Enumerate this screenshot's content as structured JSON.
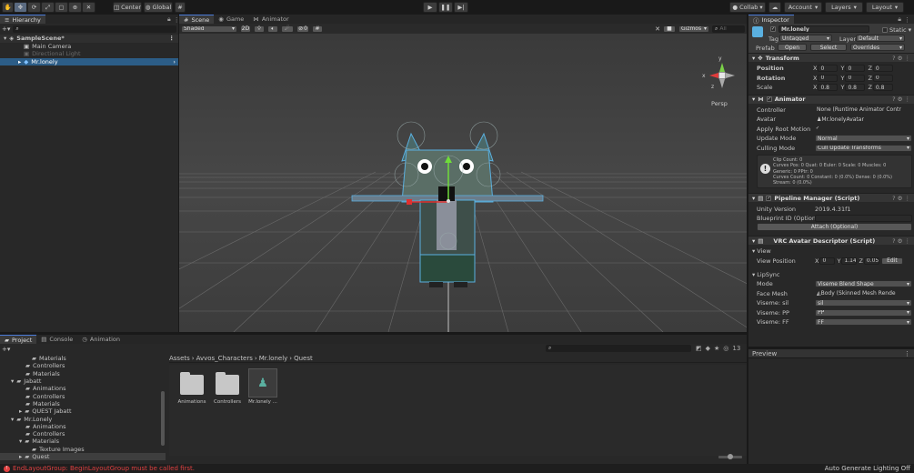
{
  "toolbar": {
    "center_label": "Center",
    "global_label": "Global",
    "collab_label": "Collab",
    "account_label": "Account",
    "layers_label": "Layers",
    "layout_label": "Layout"
  },
  "hierarchy": {
    "tab_label": "Hierarchy",
    "items": [
      {
        "label": "SampleScene*"
      },
      {
        "label": "Main Camera"
      },
      {
        "label": "Directional Light"
      },
      {
        "label": "Mr.lonely"
      }
    ]
  },
  "scene": {
    "tabs": [
      {
        "label": "Scene"
      },
      {
        "label": "Game"
      },
      {
        "label": "Animator"
      }
    ],
    "shading": "Shaded",
    "mode_2d": "2D",
    "fx_count": "0",
    "gizmos_label": "Gizmos",
    "search_placeholder": "All",
    "persp_label": "Persp",
    "gizmo_axes": {
      "x": "x",
      "y": "y",
      "z": "z"
    }
  },
  "inspector": {
    "tab_label": "Inspector",
    "object_name": "Mr.lonely",
    "static_label": "Static",
    "tag_label": "Tag",
    "tag_value": "Untagged",
    "layer_label": "Layer",
    "layer_value": "Default",
    "prefab_label": "Prefab",
    "open_label": "Open",
    "select_label": "Select",
    "overrides_label": "Overrides",
    "transform": {
      "title": "Transform",
      "position_label": "Position",
      "rotation_label": "Rotation",
      "scale_label": "Scale",
      "position": {
        "x": "0",
        "y": "0",
        "z": "0"
      },
      "rotation": {
        "x": "0",
        "y": "0",
        "z": "0"
      },
      "scale": {
        "x": "0.8",
        "y": "0.8",
        "z": "0.8"
      }
    },
    "animator": {
      "title": "Animator",
      "controller_label": "Controller",
      "controller_value": "None (Runtime Animator Contr",
      "avatar_label": "Avatar",
      "avatar_value": "Mr.lonelyAvatar",
      "root_motion_label": "Apply Root Motion",
      "update_mode_label": "Update Mode",
      "update_mode_value": "Normal",
      "culling_label": "Culling Mode",
      "culling_value": "Cull Update Transforms",
      "info_lines": [
        "Clip Count: 0",
        "Curves Pos: 0 Quat: 0 Euler: 0 Scale: 0 Muscles: 0",
        "Generic: 0 PPtr: 0",
        "Curves Count: 0 Constant: 0 (0.0%) Dense: 0 (0.0%)",
        "Stream: 0 (0.0%)"
      ]
    },
    "pipeline": {
      "title": "Pipeline Manager (Script)",
      "unity_version_label": "Unity Version",
      "unity_version_value": "2019.4.31f1",
      "blueprint_label": "Blueprint ID (Optional",
      "attach_label": "Attach (Optional)"
    },
    "descriptor": {
      "title": "VRC Avatar Descriptor (Script)",
      "view_label": "View",
      "view_position_label": "View Position",
      "view_position": {
        "x": "0",
        "y": "1.14",
        "z": "0.05"
      },
      "edit_label": "Edit",
      "lipsync_label": "LipSync",
      "mode_label": "Mode",
      "mode_value": "Viseme Blend Shape",
      "face_mesh_label": "Face Mesh",
      "face_mesh_value": "Body (Skinned Mesh Rende",
      "visemes": [
        {
          "label": "Viseme: sil",
          "value": "sil"
        },
        {
          "label": "Viseme: PP",
          "value": "PP"
        },
        {
          "label": "Viseme: FF",
          "value": "FF"
        }
      ]
    },
    "preview_label": "Preview"
  },
  "project": {
    "tabs": [
      {
        "label": "Project"
      },
      {
        "label": "Console"
      },
      {
        "label": "Animation"
      }
    ],
    "count_badge": "13",
    "tree": [
      {
        "label": "Materials",
        "indent": 2
      },
      {
        "label": "Controllers",
        "indent": 2
      },
      {
        "label": "Materials",
        "indent": 2
      },
      {
        "label": "Jabatt",
        "indent": 1
      },
      {
        "label": "Animations",
        "indent": 2
      },
      {
        "label": "Controllers",
        "indent": 2
      },
      {
        "label": "Materials",
        "indent": 2
      },
      {
        "label": "QUEST Jabatt",
        "indent": 2
      },
      {
        "label": "Mr.Lonely",
        "indent": 1
      },
      {
        "label": "Animations",
        "indent": 2
      },
      {
        "label": "Controllers",
        "indent": 2
      },
      {
        "label": "Materials",
        "indent": 2
      },
      {
        "label": "Texture Images",
        "indent": 3
      },
      {
        "label": "Quest",
        "indent": 2
      }
    ],
    "breadcrumb": [
      "Assets",
      "Avvos_Characters",
      "Mr.lonely",
      "Quest"
    ],
    "assets": [
      {
        "label": "Animations",
        "type": "folder"
      },
      {
        "label": "Controllers",
        "type": "folder"
      },
      {
        "label": "Mr.lonely ...",
        "type": "prefab"
      }
    ]
  },
  "status": {
    "error_text": "EndLayoutGroup: BeginLayoutGroup must be called first.",
    "lighting_text": "Auto Generate Lighting Off"
  },
  "colors": {
    "selection": "#2c5d87",
    "accent": "#4a7bd8",
    "error": "#e04040"
  }
}
